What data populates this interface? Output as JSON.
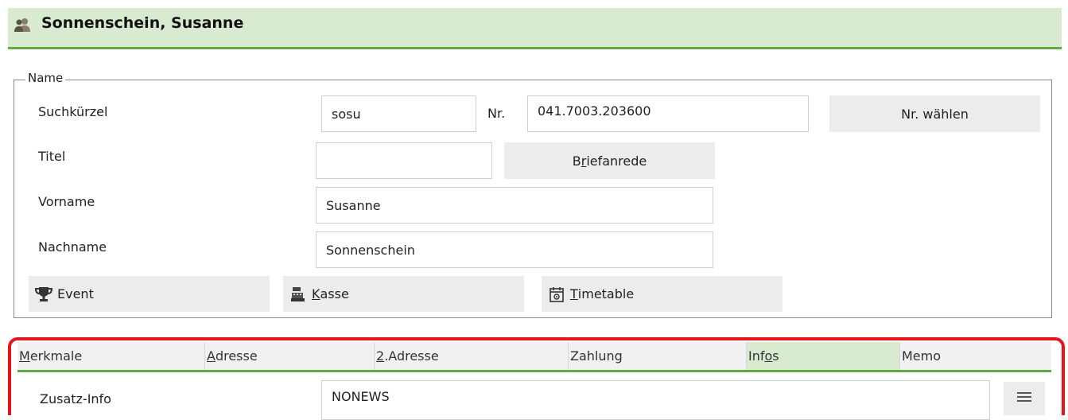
{
  "header": {
    "title": "Sonnenschein, Susanne",
    "icon": "person-group-icon"
  },
  "name_group": {
    "legend": "Name",
    "suchkuerzel_label": "Suchkürzel",
    "suchkuerzel_value": "sosu",
    "nr_label": "Nr.",
    "nr_value": "041.7003.203600",
    "nr_waehlen_button": "Nr. wählen",
    "titel_label": "Titel",
    "titel_value": "",
    "briefanrede_button": {
      "first": "B",
      "underlined": "r",
      "rest": "iefanrede"
    },
    "vorname_label": "Vorname",
    "vorname_value": "Susanne",
    "nachname_label": "Nachname",
    "nachname_value": "Sonnenschein"
  },
  "actions": {
    "event": {
      "label": "Event",
      "icon": "trophy-icon"
    },
    "kasse": {
      "underlined": "K",
      "rest": "asse",
      "icon": "cash-register-icon"
    },
    "timetable": {
      "underlined": "T",
      "rest": "imetable",
      "icon": "calendar-icon"
    }
  },
  "tabs": [
    {
      "underlined": "M",
      "rest": "erkmale",
      "active": false
    },
    {
      "underlined": "A",
      "rest": "dresse",
      "active": false
    },
    {
      "underlined": "2",
      "rest": ".Adresse",
      "active": false
    },
    {
      "underlined": "",
      "rest": "Zahlung",
      "active": false
    },
    {
      "before": "Inf",
      "underlined": "o",
      "after": "s",
      "active": true
    },
    {
      "underlined": "",
      "rest": "Memo",
      "active": false
    }
  ],
  "infos": {
    "zusatz_info_label": "Zusatz-Info",
    "zusatz_info_value": "NONEWS",
    "menu_icon": "hamburger-menu-icon"
  },
  "colors": {
    "accent_green": "#62ab42",
    "header_bg": "#d8ebd0",
    "highlight_red": "#e8141c"
  }
}
